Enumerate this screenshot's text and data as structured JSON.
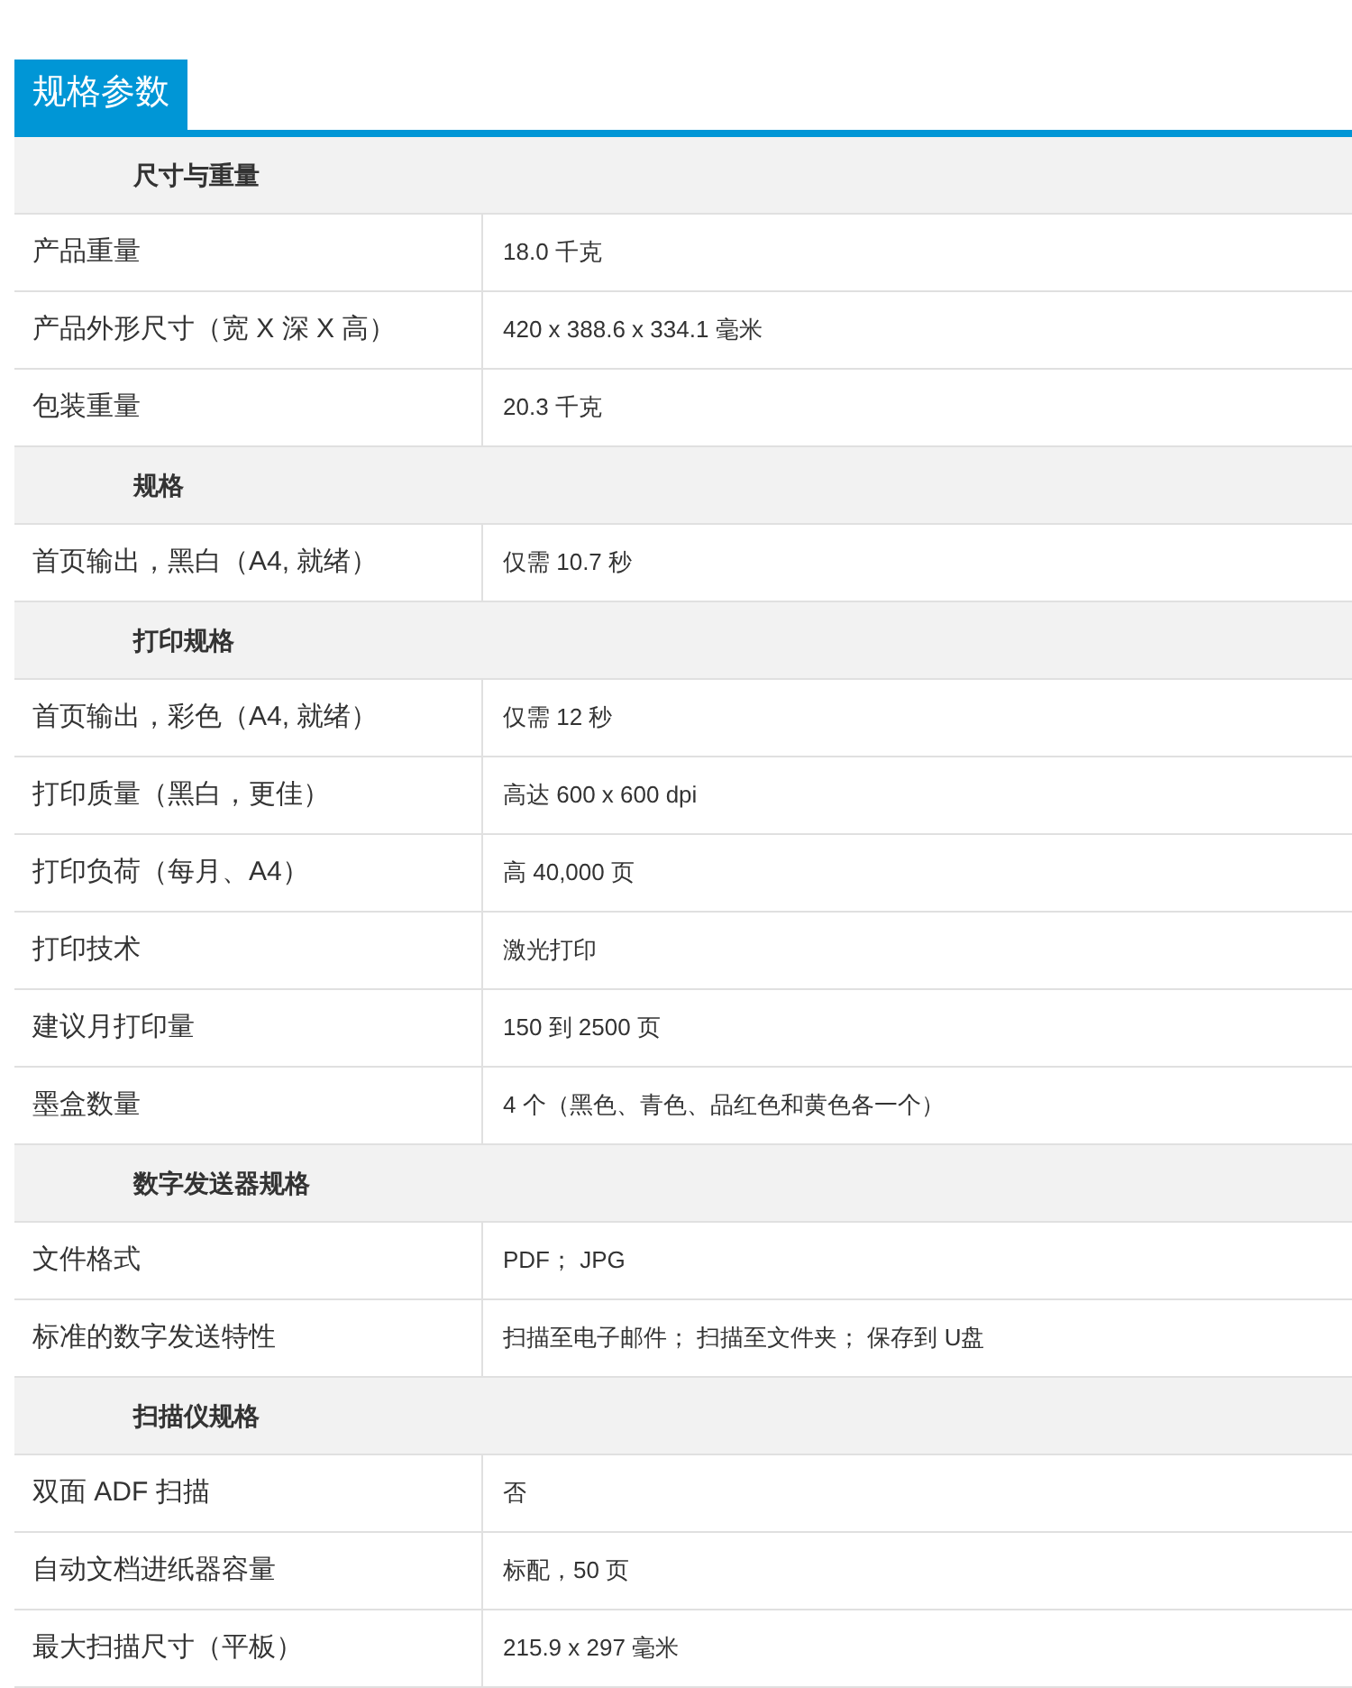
{
  "tab": {
    "label": "规格参数"
  },
  "sections": [
    {
      "title": "尺寸与重量",
      "rows": [
        {
          "label": "产品重量",
          "value": "18.0 千克"
        },
        {
          "label": "产品外形尺寸（宽 X 深 X 高）",
          "value": "420 x 388.6 x 334.1 毫米"
        },
        {
          "label": "包装重量",
          "value": "20.3 千克"
        }
      ]
    },
    {
      "title": "规格",
      "rows": [
        {
          "label": "首页输出，黑白（A4, 就绪）",
          "value": "仅需 10.7 秒"
        }
      ]
    },
    {
      "title": "打印规格",
      "rows": [
        {
          "label": "首页输出，彩色（A4, 就绪）",
          "value": "仅需 12 秒"
        },
        {
          "label": "打印质量（黑白，更佳）",
          "value": "高达 600 x 600 dpi"
        },
        {
          "label": "打印负荷（每月、A4）",
          "value": "高 40,000 页"
        },
        {
          "label": "打印技术",
          "value": "激光打印"
        },
        {
          "label": "建议月打印量",
          "value": "150 到 2500 页"
        },
        {
          "label": "墨盒数量",
          "value": "4 个（黑色、青色、品红色和黄色各一个）"
        }
      ]
    },
    {
      "title": "数字发送器规格",
      "rows": [
        {
          "label": "文件格式",
          "value": "PDF； JPG"
        },
        {
          "label": "标准的数字发送特性",
          "value": "扫描至电子邮件； 扫描至文件夹； 保存到 U盘"
        }
      ]
    },
    {
      "title": "扫描仪规格",
      "rows": [
        {
          "label": "双面 ADF 扫描",
          "value": "否"
        },
        {
          "label": "自动文档进纸器容量",
          "value": "标配，50 页"
        },
        {
          "label": "最大扫描尺寸（平板）",
          "value": "215.9 x 297 毫米"
        }
      ]
    }
  ]
}
